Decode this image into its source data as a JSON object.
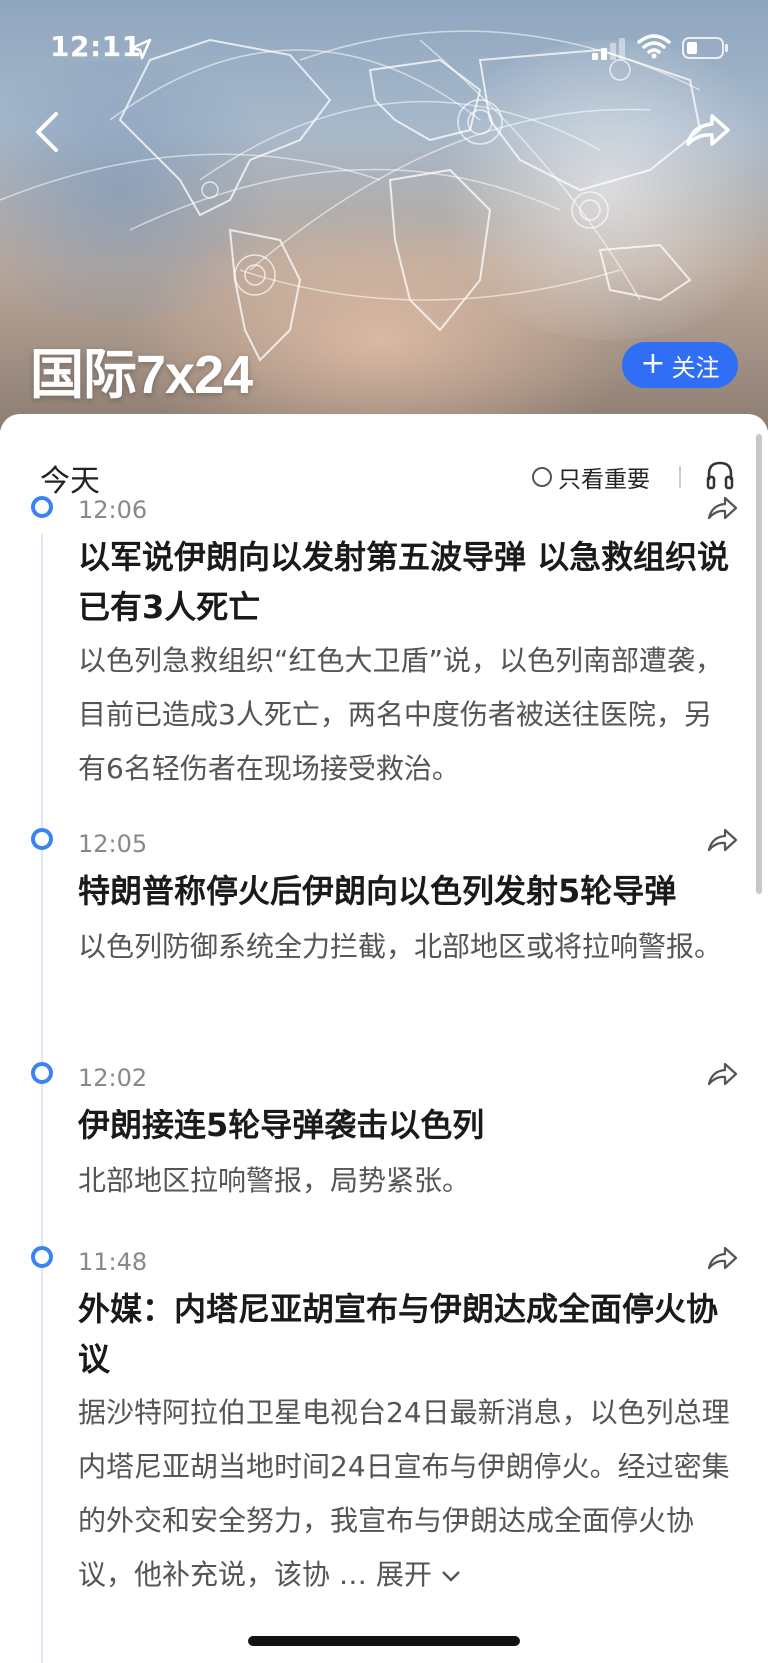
{
  "status_bar": {
    "time": "12:11"
  },
  "header": {
    "title": "国际7x24",
    "follow_label": "关注"
  },
  "toolbar": {
    "day_label": "今天",
    "filter_label": "只看重要"
  },
  "items": [
    {
      "time": "12:06",
      "headline": "以军说伊朗向以发射第五波导弹 以急救组织说已有3人死亡",
      "summary": "以色列急救组织“红色大卫盾”说，以色列南部遭袭，目前已造成3人死亡，两名中度伤者被送往医院，另有6名轻伤者在现场接受救治。"
    },
    {
      "time": "12:05",
      "headline": "特朗普称停火后伊朗向以色列发射5轮导弹",
      "summary": "以色列防御系统全力拦截，北部地区或将拉响警报。"
    },
    {
      "time": "12:02",
      "headline": "伊朗接连5轮导弹袭击以色列",
      "summary": "北部地区拉响警报，局势紧张。"
    },
    {
      "time": "11:48",
      "headline": "外媒：内塔尼亚胡宣布与伊朗达成全面停火协议",
      "summary": "据沙特阿拉伯卫星电视台24日最新消息，以色列总理内塔尼亚胡当地时间24日宣布与伊朗停火。经过密集的外交和安全努力，我宣布与伊朗达成全面停火协议，他补充说，该协",
      "expand_label": "展开"
    }
  ],
  "colors": {
    "accent": "#2f6ef5",
    "timeline_dot": "#3b82f6"
  },
  "icons": [
    "location-arrow-icon",
    "signal-icon",
    "wifi-icon",
    "battery-icon",
    "back-icon",
    "share-icon",
    "headphone-icon",
    "plus-icon",
    "chevron-down-icon"
  ]
}
